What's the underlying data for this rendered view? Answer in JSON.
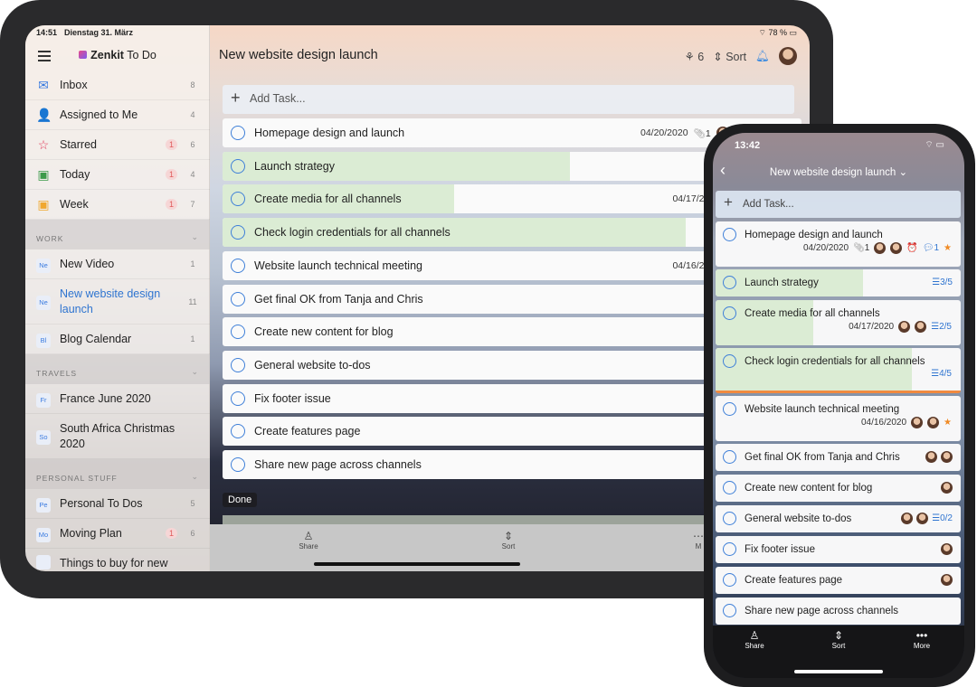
{
  "tablet": {
    "status": {
      "time": "14:51",
      "date": "Dienstag 31. März",
      "battery": "78 %"
    },
    "brand": {
      "name_bold": "Zenkit",
      "name_rest": " To Do"
    },
    "sidebar": {
      "smart_lists": [
        {
          "label": "Inbox",
          "icon": "inbox-icon",
          "glyph": "✉",
          "color": "#3a7be0",
          "count": "8"
        },
        {
          "label": "Assigned to Me",
          "icon": "person-icon",
          "glyph": "👤",
          "color": "#b0468a",
          "count": "4"
        },
        {
          "label": "Starred",
          "icon": "star-icon",
          "glyph": "☆",
          "color": "#e03a5a",
          "badge": "1",
          "count": "6"
        },
        {
          "label": "Today",
          "icon": "calendar-today-icon",
          "glyph": "▣",
          "color": "#3c9a4a",
          "badge": "1",
          "count": "4"
        },
        {
          "label": "Week",
          "icon": "calendar-week-icon",
          "glyph": "▣",
          "color": "#f0a830",
          "badge": "1",
          "count": "7"
        }
      ],
      "groups": [
        {
          "title": "WORK",
          "items": [
            {
              "abbr": "Ne",
              "label": "New Video",
              "count": "1"
            },
            {
              "abbr": "Ne",
              "label": "New website design launch",
              "count": "11",
              "active": true
            },
            {
              "abbr": "Bl",
              "label": "Blog Calendar",
              "count": "1"
            }
          ]
        },
        {
          "title": "TRAVELS",
          "items": [
            {
              "abbr": "Fr",
              "label": "France June 2020"
            },
            {
              "abbr": "So",
              "label": "South Africa Christmas 2020"
            }
          ]
        },
        {
          "title": "PERSONAL STUFF",
          "items": [
            {
              "abbr": "Pe",
              "label": "Personal To Dos",
              "count": "5"
            },
            {
              "abbr": "Mo",
              "label": "Moving Plan",
              "badge": "1",
              "count": "6"
            },
            {
              "abbr": "",
              "label": "Things to buy for new"
            }
          ]
        }
      ]
    },
    "header": {
      "title": "New website design launch",
      "members": "6",
      "sort_label": "Sort"
    },
    "add_task_placeholder": "Add Task...",
    "tasks": [
      {
        "title": "Homepage design and launch",
        "date": "04/20/2020",
        "attachments": "1",
        "comments": "1"
      },
      {
        "title": "Launch strategy",
        "progress": 0.6
      },
      {
        "title": "Create media for all channels",
        "progress": 0.4,
        "date": "04/17/2020"
      },
      {
        "title": "Check login credentials for all channels",
        "progress": 0.8
      },
      {
        "title": "Website launch technical meeting",
        "date": "04/16/2020"
      },
      {
        "title": "Get final OK from Tanja and Chris"
      },
      {
        "title": "Create new content for blog"
      },
      {
        "title": "General website to-dos"
      },
      {
        "title": "Fix footer issue"
      },
      {
        "title": "Create features page"
      },
      {
        "title": "Share new page across channels"
      }
    ],
    "done_label": "Done",
    "bottom": {
      "share": "Share",
      "sort": "Sort",
      "more": "M"
    }
  },
  "phone": {
    "time": "13:42",
    "title": "New website design launch",
    "add_task_placeholder": "Add Task...",
    "tasks": [
      {
        "title": "Homepage design and launch",
        "date": "04/20/2020",
        "attachments": "1",
        "comments": "1",
        "avatars": 2,
        "starred": true
      },
      {
        "title": "Launch strategy",
        "progress": 0.6,
        "subtasks": "3/5"
      },
      {
        "title": "Create media for all channels",
        "progress": 0.4,
        "date": "04/17/2020",
        "avatars": 2,
        "subtasks": "2/5"
      },
      {
        "title": "Check login credentials for all channels",
        "progress": 0.8,
        "subtasks": "4/5"
      },
      {
        "title": "Website launch technical meeting",
        "date": "04/16/2020",
        "avatars": 2,
        "starred": true
      },
      {
        "title": "Get final OK from Tanja and Chris",
        "avatars": 2
      },
      {
        "title": "Create new content for blog",
        "avatars": 1
      },
      {
        "title": "General website to-dos",
        "avatars": 2,
        "subtasks": "0/2"
      },
      {
        "title": "Fix footer issue",
        "avatars": 1
      },
      {
        "title": "Create features page",
        "avatars": 1
      },
      {
        "title": "Share new page across channels"
      }
    ],
    "bottom": {
      "share": "Share",
      "sort": "Sort",
      "more": "More"
    }
  }
}
